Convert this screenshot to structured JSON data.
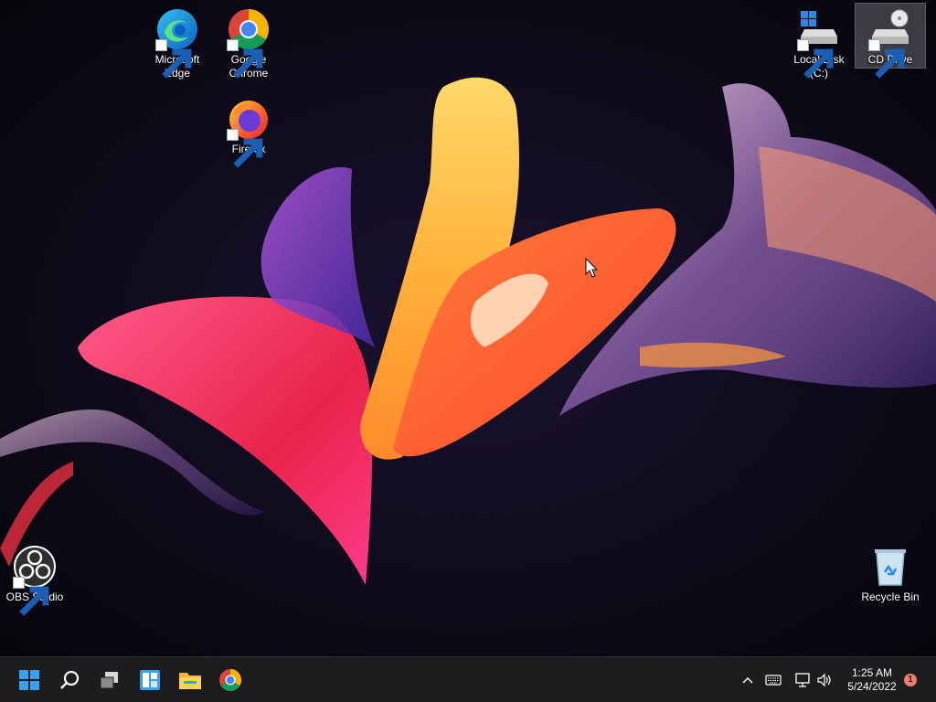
{
  "desktop": {
    "icons": [
      {
        "label": "Microsoft\nEdge",
        "icon": "edge-icon"
      },
      {
        "label": "Google\nChrome",
        "icon": "chrome-icon"
      },
      {
        "label": "Firefox",
        "icon": "firefox-icon"
      },
      {
        "label": "Local Disk (C:)",
        "icon": "local-disk-icon"
      },
      {
        "label": "CD Drive",
        "icon": "cd-drive-icon"
      },
      {
        "label": "OBS Studio",
        "icon": "obs-icon"
      },
      {
        "label": "Recycle Bin",
        "icon": "recycle-bin-icon"
      }
    ]
  },
  "taskbar": {
    "pinned": [
      "start-icon",
      "search-icon",
      "task-view-icon",
      "widgets-icon",
      "file-explorer-icon",
      "chrome-icon"
    ],
    "tray": [
      "chevron-up-icon",
      "keyboard-icon",
      "network-icon",
      "volume-icon"
    ],
    "clock": {
      "time": "1:25 AM",
      "date": "5/24/2022"
    },
    "notifications": "1"
  },
  "colors": {
    "taskbar": "#1d1d20",
    "desktop_background": "#07060d",
    "accent": "#3aa0f0"
  }
}
